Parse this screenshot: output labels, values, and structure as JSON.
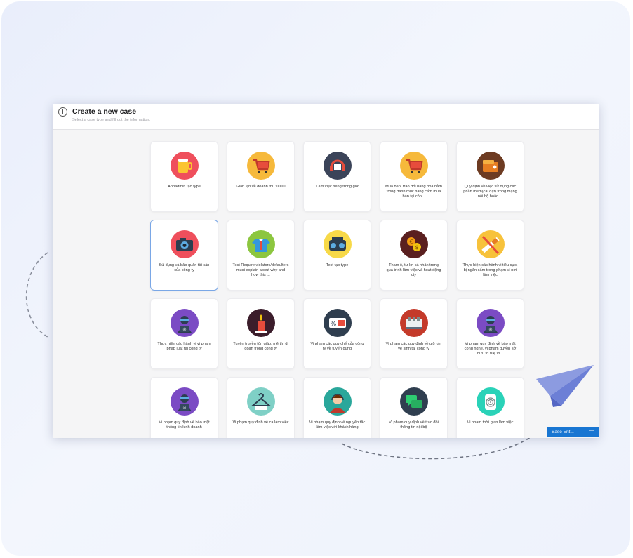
{
  "window": {
    "title": "Create a new case",
    "subtitle": "Select a case type and fill out the information."
  },
  "case_types": [
    {
      "label": "Appadmin tạo type",
      "icon": "beer-mug-icon",
      "color": "#ef4f5c"
    },
    {
      "label": "Gian lận về doanh thu tuuuu",
      "icon": "shopping-cart-icon",
      "color": "#f6b93b"
    },
    {
      "label": "Làm việc riêng trong giờ",
      "icon": "headset-icon",
      "color": "#3b4459"
    },
    {
      "label": "Mua bán, trao đổi hàng hoá nằm trong danh mục hàng cấm mua bán tại côn...",
      "icon": "shopping-cart-icon",
      "color": "#f6b93b"
    },
    {
      "label": "Quy định về việc sử dụng các phần mềm(cài đặt) trong mạng nội bộ hoặc ...",
      "icon": "wallet-icon",
      "color": "#6d3b22"
    },
    {
      "label": "Sử dụng và bảo quản tài sản của công ty",
      "icon": "camera-icon",
      "color": "#ef4f5c"
    },
    {
      "label": "Test Require violators/defaulters must explain about why and how this ...",
      "icon": "shirt-icon",
      "color": "#8cc63f"
    },
    {
      "label": "Test tạo type",
      "icon": "radio-icon",
      "color": "#f7d948"
    },
    {
      "label": "Tham ô, tư lợi cá nhân trong quá trình làm việc và hoạt động cty",
      "icon": "coins-icon",
      "color": "#5a1f1f"
    },
    {
      "label": "Thực hiện các hành vi tiêu cực, bị ngăn cấm trong phạm vi nơi làm việc",
      "icon": "cigarette-icon",
      "color": "#f7c23b"
    },
    {
      "label": "Thực hiện các hành vi vi phạm pháp luật tại công ty",
      "icon": "hacker-icon",
      "color": "#7b4bc4"
    },
    {
      "label": "Tuyên truyền tôn giáo, mê tín dị đoan trong công ty",
      "icon": "candle-icon",
      "color": "#3b1d2b"
    },
    {
      "label": "Vi phạm các quy chế của công ty về tuyển dụng",
      "icon": "discount-sign-icon",
      "color": "#2f3e4f"
    },
    {
      "label": "Vi phạm các quy định về giữ gìn vệ sinh tại công ty",
      "icon": "desk-icon",
      "color": "#c43a2a"
    },
    {
      "label": "Vi phạm quy định về bảo mật công nghệ, vi phạm quyền sở hữu trí tuệ Vi...",
      "icon": "hacker-icon",
      "color": "#7b4bc4"
    },
    {
      "label": "Vi phạm quy định về bảo mật thông tin kinh doanh",
      "icon": "hacker-icon",
      "color": "#7b4bc4"
    },
    {
      "label": "Vi phạm quy định về ca làm việc",
      "icon": "hanger-icon",
      "color": "#7fd0c6"
    },
    {
      "label": "Vi phạm quy định về nguyên tắc làm việc với khách hàng",
      "icon": "operator-icon",
      "color": "#2aa79b"
    },
    {
      "label": "Vi phạm quy định về trao đổi thông tin nội bộ",
      "icon": "chat-icon",
      "color": "#2f3e4f"
    },
    {
      "label": "Vi phạm thời gian làm việc",
      "icon": "fingerprint-icon",
      "color": "#2ad2b8"
    }
  ],
  "base_bar": {
    "label": "Base Ent...",
    "minimize": "—"
  }
}
